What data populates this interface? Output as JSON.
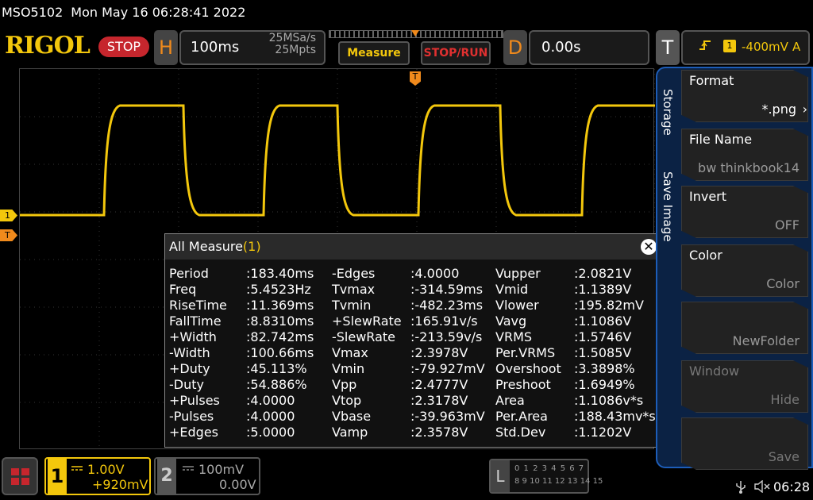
{
  "status": {
    "model": "MSO5102",
    "datetime": "Mon May 16 06:28:41 2022"
  },
  "brand": "RIGOL",
  "run_state": "STOP",
  "horizontal": {
    "letter": "H",
    "timebase": "100ms",
    "sample_rate": "25MSa/s",
    "memory_depth": "25Mpts"
  },
  "delay": {
    "letter": "D",
    "value": "0.00s"
  },
  "trigger": {
    "letter": "T",
    "icon": "rising-edge-icon",
    "source": "1",
    "level": "-400mV",
    "mode": "A"
  },
  "buttons": {
    "measure": "Measure",
    "stop_run": "STOP/RUN"
  },
  "markers": {
    "ch1": "1",
    "trig_level": "T",
    "trig_time": "T"
  },
  "measure": {
    "title": "All Measure",
    "count": "(1)",
    "close": "✕",
    "columns": [
      [
        [
          "Period",
          ":183.40ms"
        ],
        [
          "Freq",
          ":5.4523Hz"
        ],
        [
          "RiseTime",
          ":11.369ms"
        ],
        [
          "FallTime",
          ":8.8310ms"
        ],
        [
          "+Width",
          ":82.742ms"
        ],
        [
          "-Width",
          ":100.66ms"
        ],
        [
          "+Duty",
          ":45.113%"
        ],
        [
          "-Duty",
          ":54.886%"
        ],
        [
          "+Pulses",
          ":4.0000"
        ],
        [
          "-Pulses",
          ":4.0000"
        ],
        [
          "+Edges",
          ":5.0000"
        ]
      ],
      [
        [
          "-Edges",
          ":4.0000"
        ],
        [
          "Tvmax",
          ":-314.59ms"
        ],
        [
          "Tvmin",
          ":-482.23ms"
        ],
        [
          "+SlewRate",
          ":165.91v/s"
        ],
        [
          "-SlewRate",
          ":-213.59v/s"
        ],
        [
          "Vmax",
          ":2.3978V"
        ],
        [
          "Vmin",
          ":-79.927mV"
        ],
        [
          "Vpp",
          ":2.4777V"
        ],
        [
          "Vtop",
          ":2.3178V"
        ],
        [
          "Vbase",
          ":-39.963mV"
        ],
        [
          "Vamp",
          ":2.3578V"
        ]
      ],
      [
        [
          "Vupper",
          ":2.0821V"
        ],
        [
          "Vmid",
          ":1.1389V"
        ],
        [
          "Vlower",
          ":195.82mV"
        ],
        [
          "Vavg",
          ":1.1086V"
        ],
        [
          "VRMS",
          ":1.5746V"
        ],
        [
          "Per.VRMS",
          ":1.5085V"
        ],
        [
          "Overshoot",
          ":3.3898%"
        ],
        [
          "Preshoot",
          ":1.6949%"
        ],
        [
          "Area",
          ":1.1086v*s"
        ],
        [
          "Per.Area",
          ":188.43mv*s"
        ],
        [
          "Std.Dev",
          ":1.1202V"
        ]
      ]
    ]
  },
  "side_tabs": {
    "storage": "Storage",
    "save_image": "Save Image"
  },
  "side_menu": [
    {
      "title": "Format",
      "value": "*.png",
      "state": "active"
    },
    {
      "title": "File Name",
      "value": "bw thinkbook14",
      "state": "normal"
    },
    {
      "title": "Invert",
      "value": "OFF",
      "state": "normal"
    },
    {
      "title": "Color",
      "value": "Color",
      "state": "normal"
    },
    {
      "title": "",
      "value": "NewFolder",
      "state": "normal"
    },
    {
      "title": "Window",
      "value": "Hide",
      "state": "dim"
    },
    {
      "title": "",
      "value": "Save",
      "state": "dim"
    }
  ],
  "channels": {
    "ch1": {
      "num": "1",
      "coupling": "DC",
      "scale": "1.00V",
      "offset": "+920mV"
    },
    "ch2": {
      "num": "2",
      "coupling": "DC",
      "scale": "100mV",
      "offset": "0.00V"
    }
  },
  "la": {
    "letter": "L",
    "row1": "0 1 2 3  4 5 6 7",
    "row2": "8 9 10 11 12 13 14 15"
  },
  "system": {
    "usb_icon": "usb-icon",
    "speaker_icon": "speaker-muted-icon",
    "clock": "06:28"
  },
  "colors": {
    "ch1": "#f3c70c",
    "trigger": "#f08a1c",
    "stop": "#c6262d",
    "menu_bg": "#0b2244"
  }
}
